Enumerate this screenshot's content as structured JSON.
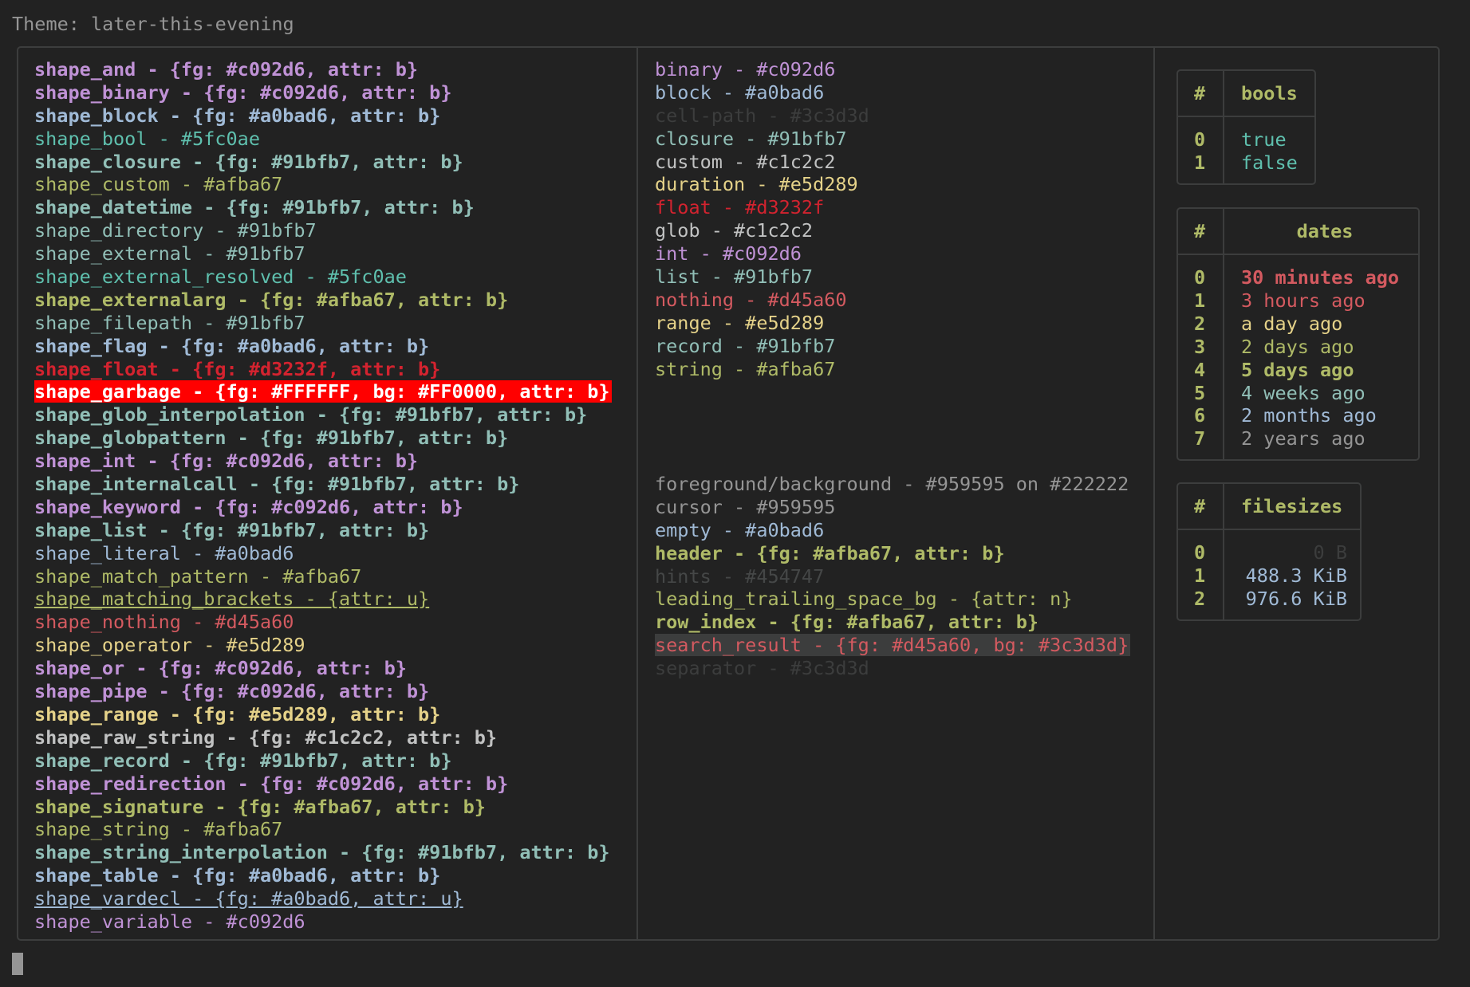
{
  "title": "Theme: later-this-evening",
  "col1": [
    {
      "text": "shape_and - {fg: #c092d6, attr: b}",
      "color": "#c092d6",
      "bold": true
    },
    {
      "text": "shape_binary - {fg: #c092d6, attr: b}",
      "color": "#c092d6",
      "bold": true
    },
    {
      "text": "shape_block - {fg: #a0bad6, attr: b}",
      "color": "#a0bad6",
      "bold": true
    },
    {
      "text": "shape_bool - #5fc0ae",
      "color": "#5fc0ae"
    },
    {
      "text": "shape_closure - {fg: #91bfb7, attr: b}",
      "color": "#91bfb7",
      "bold": true
    },
    {
      "text": "shape_custom - #afba67",
      "color": "#afba67"
    },
    {
      "text": "shape_datetime - {fg: #91bfb7, attr: b}",
      "color": "#91bfb7",
      "bold": true
    },
    {
      "text": "shape_directory - #91bfb7",
      "color": "#91bfb7"
    },
    {
      "text": "shape_external - #91bfb7",
      "color": "#91bfb7"
    },
    {
      "text": "shape_external_resolved - #5fc0ae",
      "color": "#5fc0ae"
    },
    {
      "text": "shape_externalarg - {fg: #afba67, attr: b}",
      "color": "#afba67",
      "bold": true
    },
    {
      "text": "shape_filepath - #91bfb7",
      "color": "#91bfb7"
    },
    {
      "text": "shape_flag - {fg: #a0bad6, attr: b}",
      "color": "#a0bad6",
      "bold": true
    },
    {
      "text": "shape_float - {fg: #d3232f, attr: b}",
      "color": "#d3232f",
      "bold": true
    },
    {
      "text": "shape_garbage - {fg: #FFFFFF, bg: #FF0000, attr: b}",
      "color": "#FFFFFF",
      "bg": "#FF0000",
      "bold": true
    },
    {
      "text": "shape_glob_interpolation - {fg: #91bfb7, attr: b}",
      "color": "#91bfb7",
      "bold": true
    },
    {
      "text": "shape_globpattern - {fg: #91bfb7, attr: b}",
      "color": "#91bfb7",
      "bold": true
    },
    {
      "text": "shape_int - {fg: #c092d6, attr: b}",
      "color": "#c092d6",
      "bold": true
    },
    {
      "text": "shape_internalcall - {fg: #91bfb7, attr: b}",
      "color": "#91bfb7",
      "bold": true
    },
    {
      "text": "shape_keyword - {fg: #c092d6, attr: b}",
      "color": "#c092d6",
      "bold": true
    },
    {
      "text": "shape_list - {fg: #91bfb7, attr: b}",
      "color": "#91bfb7",
      "bold": true
    },
    {
      "text": "shape_literal - #a0bad6",
      "color": "#a0bad6"
    },
    {
      "text": "shape_match_pattern - #afba67",
      "color": "#afba67"
    },
    {
      "text": "shape_matching_brackets - {attr: u}",
      "color": "#afba67",
      "underline": true
    },
    {
      "text": "shape_nothing - #d45a60",
      "color": "#d45a60"
    },
    {
      "text": "shape_operator - #e5d289",
      "color": "#e5d289"
    },
    {
      "text": "shape_or - {fg: #c092d6, attr: b}",
      "color": "#c092d6",
      "bold": true
    },
    {
      "text": "shape_pipe - {fg: #c092d6, attr: b}",
      "color": "#c092d6",
      "bold": true
    },
    {
      "text": "shape_range - {fg: #e5d289, attr: b}",
      "color": "#e5d289",
      "bold": true
    },
    {
      "text": "shape_raw_string - {fg: #c1c2c2, attr: b}",
      "color": "#c1c2c2",
      "bold": true
    },
    {
      "text": "shape_record - {fg: #91bfb7, attr: b}",
      "color": "#91bfb7",
      "bold": true
    },
    {
      "text": "shape_redirection - {fg: #c092d6, attr: b}",
      "color": "#c092d6",
      "bold": true
    },
    {
      "text": "shape_signature - {fg: #afba67, attr: b}",
      "color": "#afba67",
      "bold": true
    },
    {
      "text": "shape_string - #afba67",
      "color": "#afba67"
    },
    {
      "text": "shape_string_interpolation - {fg: #91bfb7, attr: b}",
      "color": "#91bfb7",
      "bold": true
    },
    {
      "text": "shape_table - {fg: #a0bad6, attr: b}",
      "color": "#a0bad6",
      "bold": true
    },
    {
      "text": "shape_vardecl - {fg: #a0bad6, attr: u}",
      "color": "#a0bad6",
      "underline": true
    },
    {
      "text": "shape_variable - #c092d6",
      "color": "#c092d6"
    }
  ],
  "col2_top": [
    {
      "text": "binary - #c092d6",
      "color": "#c092d6"
    },
    {
      "text": "block - #a0bad6",
      "color": "#a0bad6"
    },
    {
      "text": "cell-path - #3c3d3d",
      "color": "#3c3d3d"
    },
    {
      "text": "closure - #91bfb7",
      "color": "#91bfb7"
    },
    {
      "text": "custom - #c1c2c2",
      "color": "#c1c2c2"
    },
    {
      "text": "duration - #e5d289",
      "color": "#e5d289"
    },
    {
      "text": "float - #d3232f",
      "color": "#d3232f"
    },
    {
      "text": "glob - #c1c2c2",
      "color": "#c1c2c2"
    },
    {
      "text": "int - #c092d6",
      "color": "#c092d6"
    },
    {
      "text": "list - #91bfb7",
      "color": "#91bfb7"
    },
    {
      "text": "nothing - #d45a60",
      "color": "#d45a60"
    },
    {
      "text": "range - #e5d289",
      "color": "#e5d289"
    },
    {
      "text": "record - #91bfb7",
      "color": "#91bfb7"
    },
    {
      "text": "string - #afba67",
      "color": "#afba67"
    }
  ],
  "col2_bottom": [
    {
      "text": "foreground/background - #959595 on #222222",
      "color": "#959595"
    },
    {
      "text": "cursor - #959595",
      "color": "#959595"
    },
    {
      "text": "empty - #a0bad6",
      "color": "#a0bad6"
    },
    {
      "text": "header - {fg: #afba67, attr: b}",
      "color": "#afba67",
      "bold": true
    },
    {
      "text": "hints - #454747",
      "color": "#454747"
    },
    {
      "text": "leading_trailing_space_bg - {attr: n}",
      "color": "#afba67"
    },
    {
      "text": "row_index - {fg: #afba67, attr: b}",
      "color": "#afba67",
      "bold": true
    },
    {
      "text": "search_result - {fg: #d45a60, bg: #3c3d3d}",
      "color": "#d45a60",
      "bg": "#3c3d3d"
    },
    {
      "text": "separator - #3c3d3d",
      "color": "#3c3d3d"
    }
  ],
  "bools": {
    "index_header": "#",
    "header": "bools",
    "rows": [
      {
        "index": "0",
        "value": "true",
        "color": "#5fc0ae"
      },
      {
        "index": "1",
        "value": "false",
        "color": "#5fc0ae"
      }
    ]
  },
  "dates": {
    "index_header": "#",
    "header": "dates",
    "rows": [
      {
        "index": "0",
        "value": "30 minutes ago",
        "color": "#d45a60",
        "bold": true
      },
      {
        "index": "1",
        "value": "3 hours ago",
        "color": "#d45a60"
      },
      {
        "index": "2",
        "value": "a day ago",
        "color": "#e5d289"
      },
      {
        "index": "3",
        "value": "2 days ago",
        "color": "#afba67"
      },
      {
        "index": "4",
        "value": "5 days ago",
        "color": "#afba67",
        "bold": true
      },
      {
        "index": "5",
        "value": "4 weeks ago",
        "color": "#91bfb7"
      },
      {
        "index": "6",
        "value": "2 months ago",
        "color": "#a0bad6"
      },
      {
        "index": "7",
        "value": "2 years ago",
        "color": "#959595"
      }
    ]
  },
  "filesizes": {
    "index_header": "#",
    "header": "filesizes",
    "rows": [
      {
        "index": "0",
        "value": "0 B",
        "color": "#3c3d3d"
      },
      {
        "index": "1",
        "value": "488.3 KiB",
        "color": "#a0bad6"
      },
      {
        "index": "2",
        "value": "976.6 KiB",
        "color": "#a0bad6"
      }
    ]
  }
}
